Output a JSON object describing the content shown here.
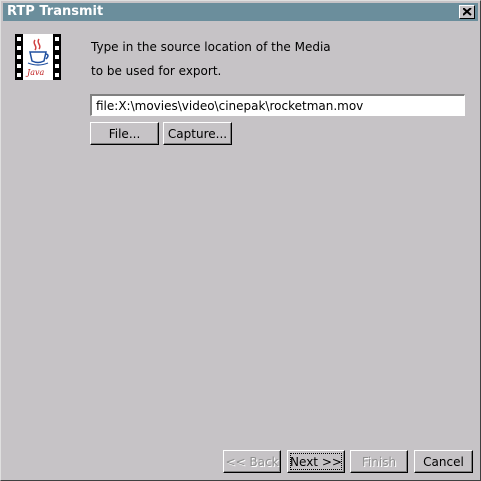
{
  "window": {
    "title": "RTP Transmit"
  },
  "icons": {
    "java": "java-film-icon",
    "close": "close-icon"
  },
  "instructions": {
    "line1": "Type in the source location of the Media",
    "line2": "to be used for export."
  },
  "source": {
    "value": "file:X:\\movies\\video\\cinepak\\rocketman.mov"
  },
  "buttons": {
    "file": "File...",
    "capture": "Capture...",
    "back": "<< Back",
    "next": "Next >>",
    "finish": "Finish",
    "cancel": "Cancel"
  },
  "colors": {
    "titlebar": "#6b8e9c",
    "background": "#c6c3c6"
  }
}
